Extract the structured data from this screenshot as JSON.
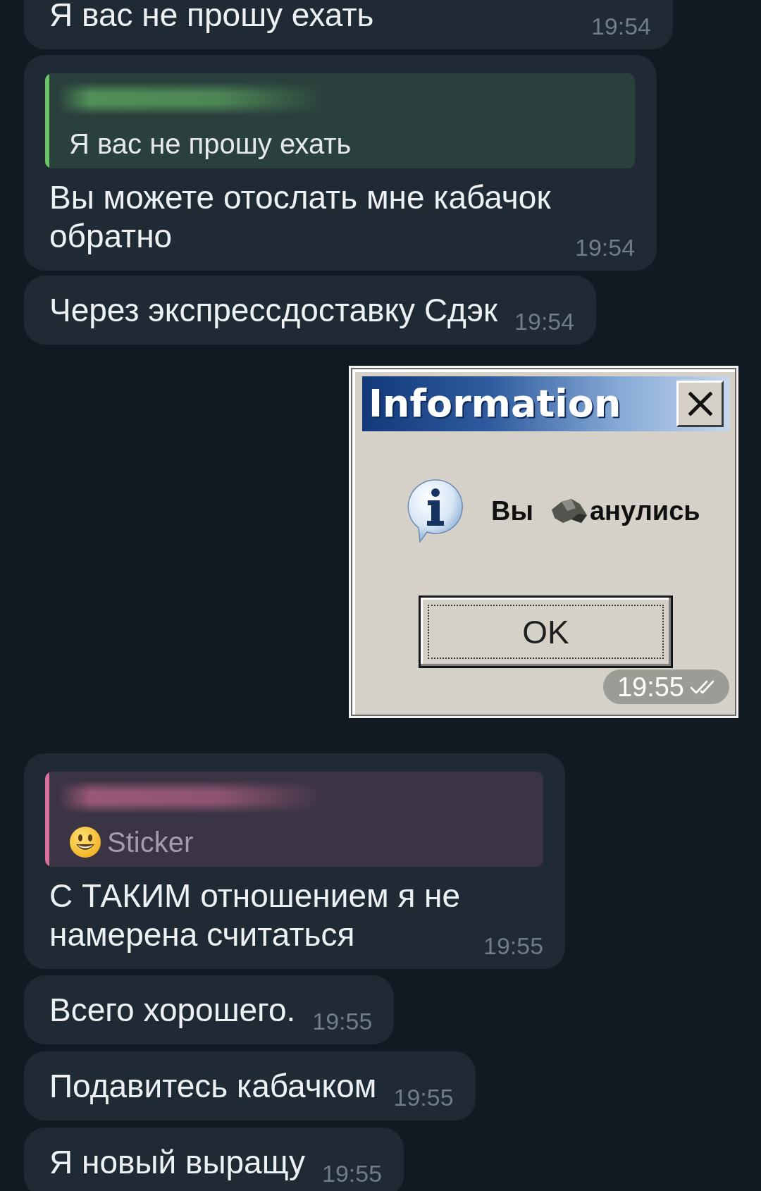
{
  "messages": [
    {
      "kind": "text",
      "outgoing": false,
      "text": "Я вас не прошу ехать",
      "time": "19:54"
    },
    {
      "kind": "text",
      "outgoing": false,
      "reply": {
        "kind": "text",
        "color": "#6cc46a",
        "text": "Я вас не прошу ехать"
      },
      "text": "Вы можете отослать мне кабачок обратно",
      "time": "19:54"
    },
    {
      "kind": "text",
      "outgoing": false,
      "text": "Через экспрессдоставку Сдэк",
      "time": "19:54"
    },
    {
      "kind": "image",
      "outgoing": true,
      "dialog": {
        "title": "Information",
        "message_parts": [
          "Вы",
          "анулись"
        ],
        "button": "OK"
      },
      "time": "19:55",
      "read": true
    },
    {
      "kind": "text",
      "outgoing": false,
      "reply": {
        "kind": "sticker",
        "color": "#d8709a",
        "text": "Sticker"
      },
      "text": "С ТАКИМ отношением я не намерена считаться",
      "time": "19:55"
    },
    {
      "kind": "text",
      "outgoing": false,
      "text": "Всего хорошего.",
      "time": "19:55"
    },
    {
      "kind": "text",
      "outgoing": false,
      "text": "Подавитесь кабачком",
      "time": "19:55"
    },
    {
      "kind": "text",
      "outgoing": false,
      "text": "Я новый выращу",
      "time": "19:55"
    }
  ]
}
